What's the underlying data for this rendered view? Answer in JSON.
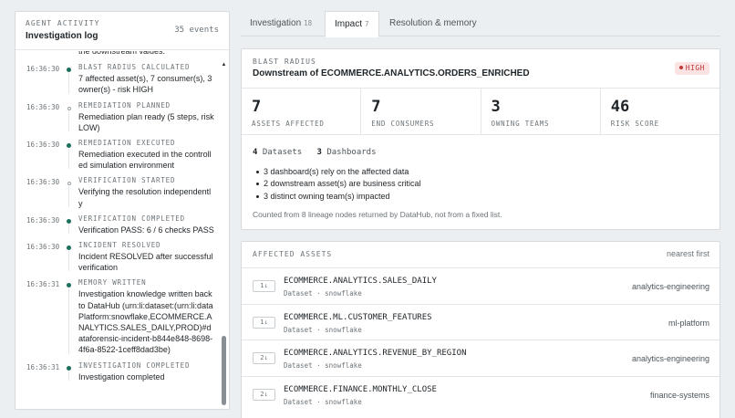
{
  "activity": {
    "kicker": "AGENT ACTIVITY",
    "title": "Investigation log",
    "events": "35 events",
    "entries": [
      {
        "time": "",
        "type": "",
        "text": "the downstream values.",
        "dot": "none"
      },
      {
        "time": "16:36:30",
        "type": "BLAST RADIUS CALCULATED",
        "text": "7 affected asset(s), 7 consumer(s), 3 owner(s) - risk HIGH",
        "dot": "solid"
      },
      {
        "time": "16:36:30",
        "type": "REMEDIATION PLANNED",
        "text": "Remediation plan ready (5 steps, risk LOW)",
        "dot": "hollow"
      },
      {
        "time": "16:36:30",
        "type": "REMEDIATION EXECUTED",
        "text": "Remediation executed in the controlled simulation environment",
        "dot": "solid"
      },
      {
        "time": "16:36:30",
        "type": "VERIFICATION STARTED",
        "text": "Verifying the resolution independently",
        "dot": "hollow"
      },
      {
        "time": "16:36:30",
        "type": "VERIFICATION COMPLETED",
        "text": "Verification PASS: 6 / 6 checks PASS",
        "dot": "solid"
      },
      {
        "time": "16:36:30",
        "type": "INCIDENT RESOLVED",
        "text": "Incident RESOLVED after successful verification",
        "dot": "solid"
      },
      {
        "time": "16:36:31",
        "type": "MEMORY WRITTEN",
        "text": "Investigation knowledge written back to DataHub (urn:li:dataset:(urn:li:dataPlatform:snowflake,ECOMMERCE.ANALYTICS.SALES_DAILY,PROD)#dataforensic-incident-b844e848-8698-4f6a-8522-1ceff8dad3be)",
        "dot": "solid"
      },
      {
        "time": "16:36:31",
        "type": "INVESTIGATION COMPLETED",
        "text": "Investigation completed",
        "dot": "solid"
      }
    ]
  },
  "tabs": [
    {
      "label": "Investigation",
      "count": "18"
    },
    {
      "label": "Impact",
      "count": "7"
    },
    {
      "label": "Resolution & memory",
      "count": ""
    }
  ],
  "blast": {
    "kicker": "BLAST RADIUS",
    "title": "Downstream of ECOMMERCE.ANALYTICS.ORDERS_ENRICHED",
    "risk": "HIGH",
    "stats": [
      {
        "value": "7",
        "label": "ASSETS AFFECTED"
      },
      {
        "value": "7",
        "label": "END CONSUMERS"
      },
      {
        "value": "3",
        "label": "OWNING TEAMS"
      },
      {
        "value": "46",
        "label": "RISK SCORE"
      }
    ],
    "datasets_count": "4",
    "datasets_label": "Datasets",
    "dashboards_count": "3",
    "dashboards_label": "Dashboards",
    "bullets": [
      "3 dashboard(s) rely on the affected data",
      "2 downstream asset(s) are business critical",
      "3 distinct owning team(s) impacted"
    ],
    "footnote": "Counted from 8 lineage nodes returned by DataHub, not from a fixed list."
  },
  "assets": {
    "kicker": "AFFECTED ASSETS",
    "sort": "nearest first",
    "rows": [
      {
        "hop": "1↓",
        "name": "ECOMMERCE.ANALYTICS.SALES_DAILY",
        "sub": "Dataset · snowflake",
        "owner": "analytics-engineering"
      },
      {
        "hop": "1↓",
        "name": "ECOMMERCE.ML.CUSTOMER_FEATURES",
        "sub": "Dataset · snowflake",
        "owner": "ml-platform"
      },
      {
        "hop": "2↓",
        "name": "ECOMMERCE.ANALYTICS.REVENUE_BY_REGION",
        "sub": "Dataset · snowflake",
        "owner": "analytics-engineering"
      },
      {
        "hop": "2↓",
        "name": "ECOMMERCE.FINANCE.MONTHLY_CLOSE",
        "sub": "Dataset · snowflake",
        "owner": "finance-systems"
      }
    ]
  },
  "colors": {
    "accent": "#1b6f5c",
    "risk": "#c03a3a"
  }
}
